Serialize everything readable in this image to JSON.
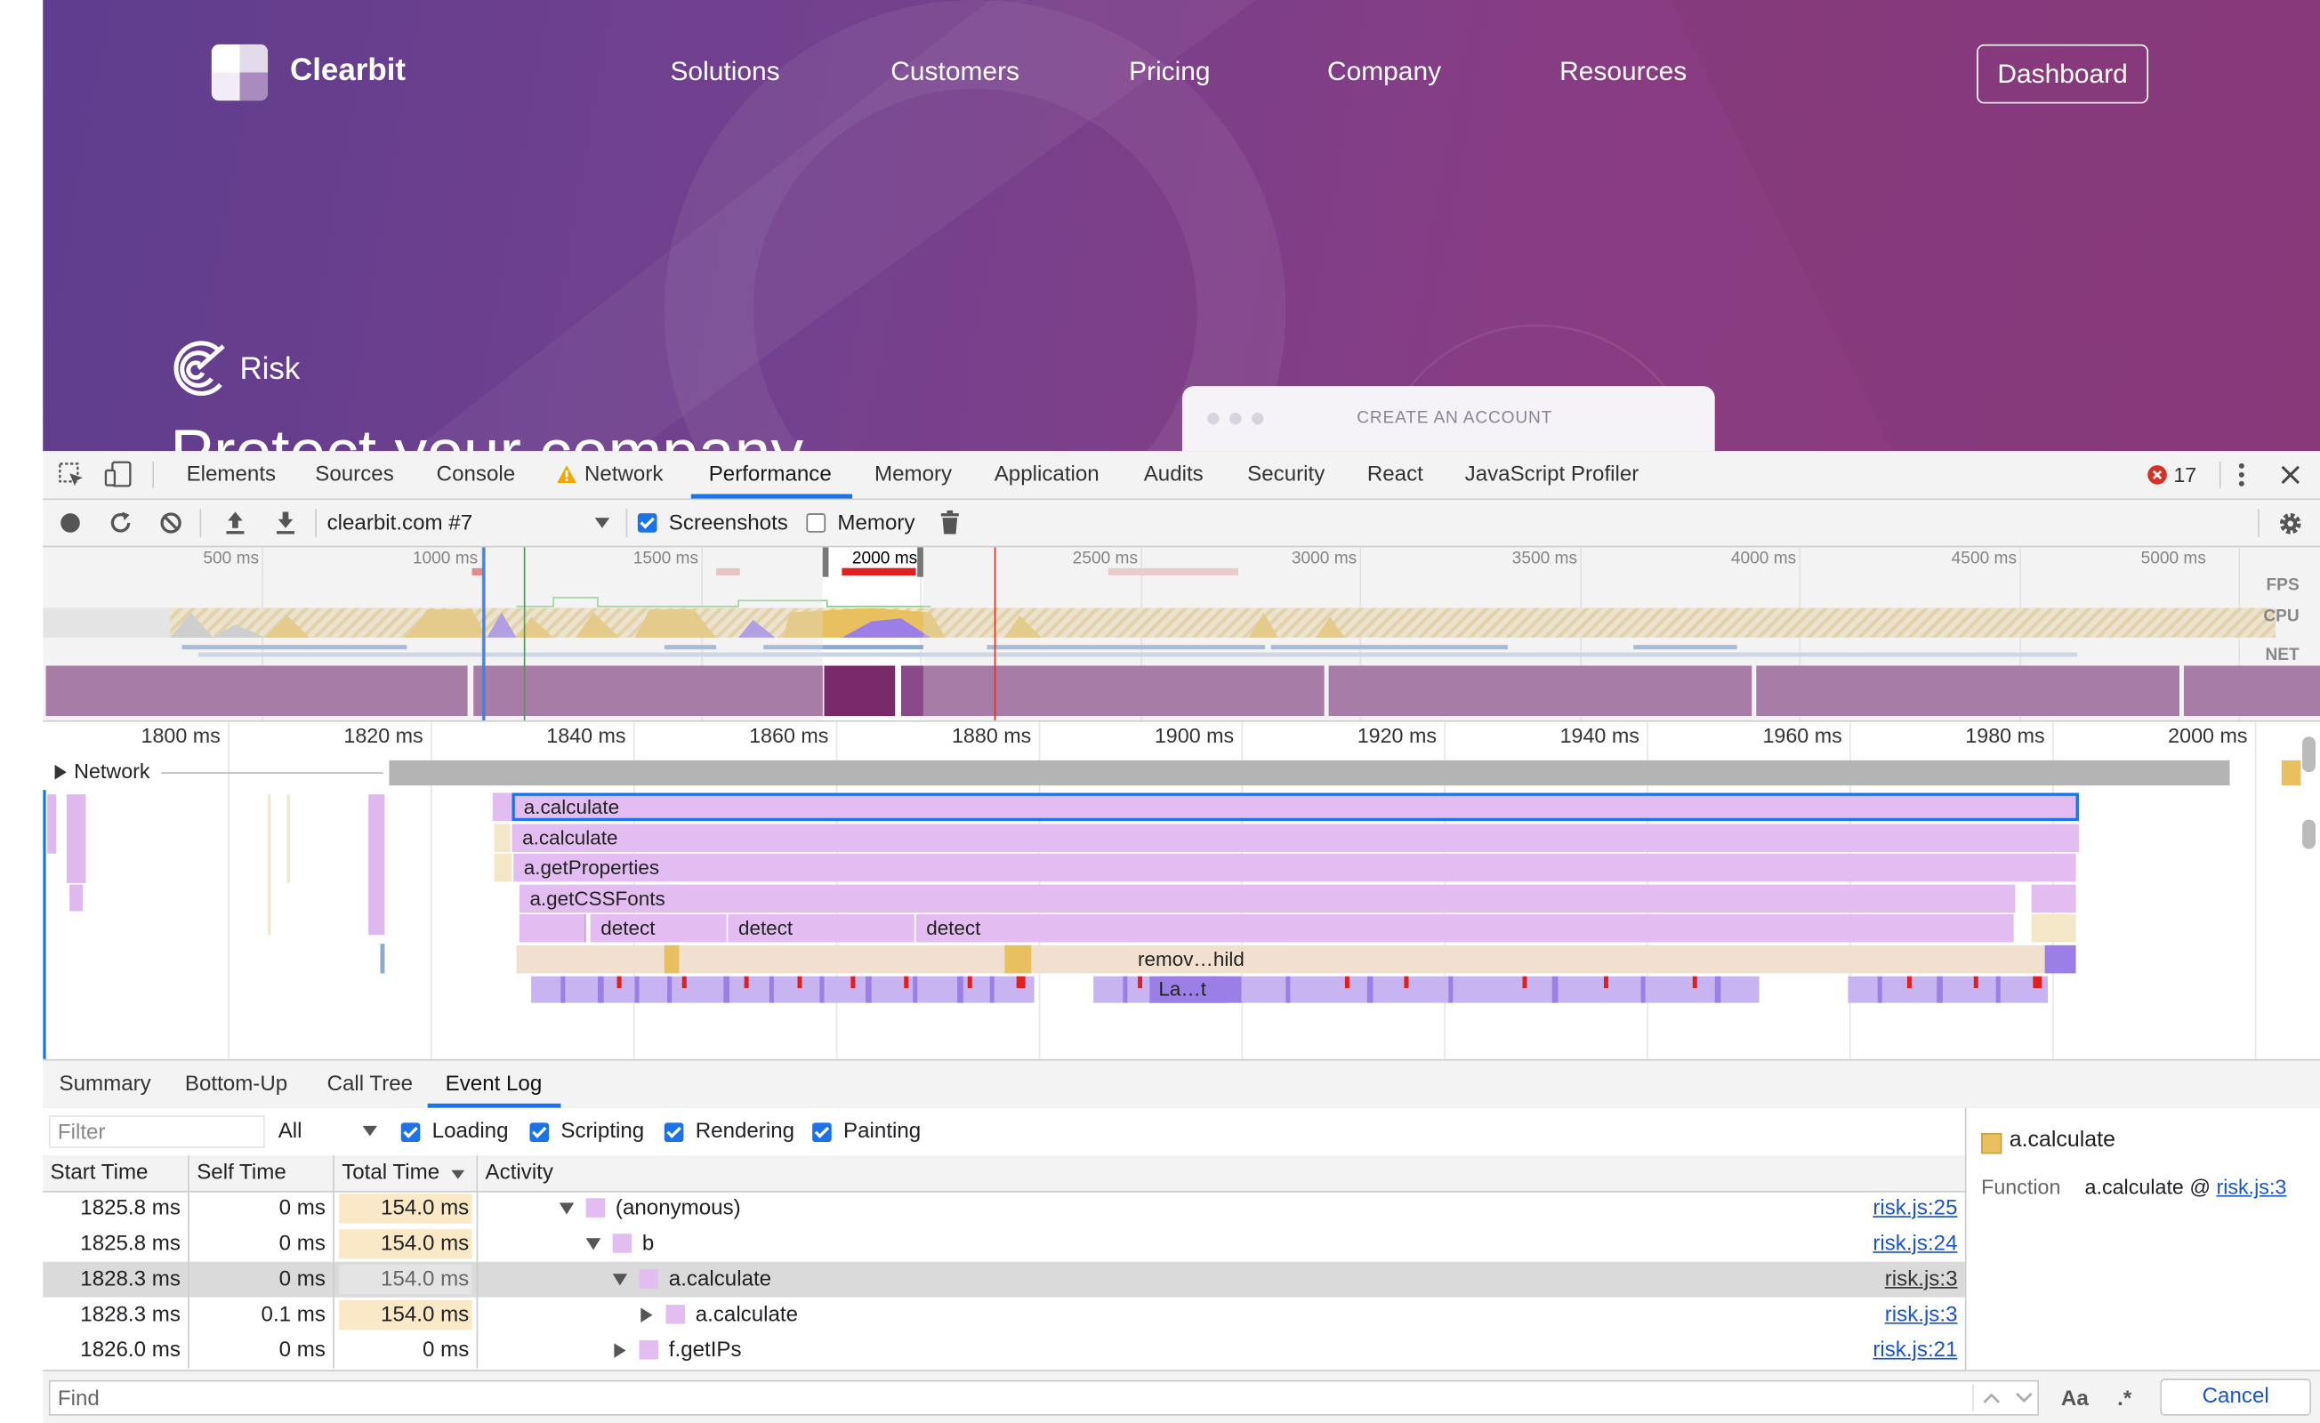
{
  "site": {
    "brand": "Clearbit",
    "nav": [
      "Solutions",
      "Customers",
      "Pricing",
      "Company",
      "Resources"
    ],
    "dashboard_label": "Dashboard",
    "product": "Risk",
    "headline": "Protect your company",
    "card_label": "CREATE AN ACCOUNT"
  },
  "devtools": {
    "tabs": [
      "Elements",
      "Sources",
      "Console",
      "Network",
      "Performance",
      "Memory",
      "Application",
      "Audits",
      "Security",
      "React",
      "JavaScript Profiler"
    ],
    "active_tab": "Performance",
    "error_count": "17",
    "toolbar": {
      "recording": "clearbit.com #7",
      "screenshots_label": "Screenshots",
      "screenshots_checked": true,
      "memory_label": "Memory",
      "memory_checked": false
    },
    "overview": {
      "ticks": [
        "500 ms",
        "1000 ms",
        "1500 ms",
        "2000 ms",
        "2500 ms",
        "3000 ms",
        "3500 ms",
        "4000 ms",
        "4500 ms",
        "5000 ms"
      ],
      "lanes": [
        "FPS",
        "CPU",
        "NET"
      ]
    },
    "flame": {
      "ticks": [
        "1800 ms",
        "1820 ms",
        "1840 ms",
        "1860 ms",
        "1880 ms",
        "1900 ms",
        "1920 ms",
        "1940 ms",
        "1960 ms",
        "1980 ms",
        "2000 ms"
      ],
      "network_label": "Network",
      "entries": [
        "a.calculate",
        "a.calculate",
        "a.getProperties",
        "a.getCSSFonts",
        "detect",
        "detect",
        "detect",
        "remov…hild",
        "La…t"
      ]
    },
    "bottom_tabs": [
      "Summary",
      "Bottom-Up",
      "Call Tree",
      "Event Log"
    ],
    "active_bottom_tab": "Event Log",
    "filter": {
      "placeholder": "Filter",
      "level": "All",
      "categories": [
        "Loading",
        "Scripting",
        "Rendering",
        "Painting"
      ]
    },
    "table": {
      "headers": [
        "Start Time",
        "Self Time",
        "Total Time",
        "Activity"
      ],
      "rows": [
        {
          "start": "1825.8 ms",
          "self": "0 ms",
          "total": "154.0 ms",
          "activity": "(anonymous)",
          "link": "risk.js:25"
        },
        {
          "start": "1825.8 ms",
          "self": "0 ms",
          "total": "154.0 ms",
          "activity": "b",
          "link": "risk.js:24"
        },
        {
          "start": "1828.3 ms",
          "self": "0 ms",
          "total": "154.0 ms",
          "activity": "a.calculate",
          "link": "risk.js:3"
        },
        {
          "start": "1828.3 ms",
          "self": "0.1 ms",
          "total": "154.0 ms",
          "activity": "a.calculate",
          "link": "risk.js:3"
        },
        {
          "start": "1826.0 ms",
          "self": "0 ms",
          "total": "0 ms",
          "activity": "f.getIPs",
          "link": "risk.js:21"
        }
      ]
    },
    "details": {
      "title": "a.calculate",
      "function_label": "Function",
      "function_value": "a.calculate @ ",
      "function_link": "risk.js:3"
    },
    "find": {
      "placeholder": "Find",
      "case_label": "Aa",
      "regex_label": ".*",
      "cancel_label": "Cancel"
    }
  },
  "colors": {
    "accent": "#1a73e8",
    "scripting": "#e0b8f0",
    "rendering": "#9b7fe6",
    "loading": "#e8c060",
    "error": "#d93025"
  }
}
